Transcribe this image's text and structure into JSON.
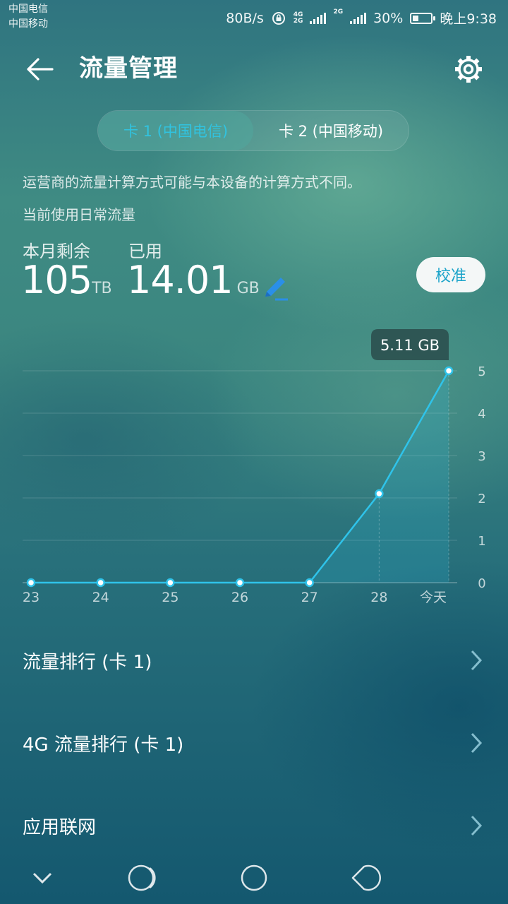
{
  "status_bar": {
    "carrier_1": "中国电信",
    "carrier_2": "中国移动",
    "speed": "80B/s",
    "net_1": "4G",
    "net_1b": "2G",
    "net_2": "2G",
    "battery": "30%",
    "battery_level": 0.3,
    "time": "晚上9:38"
  },
  "header": {
    "title": "流量管理"
  },
  "tabs": [
    {
      "label": "卡 1 (中国电信)",
      "active": true
    },
    {
      "label": "卡 2 (中国移动)",
      "active": false
    }
  ],
  "notice": "运营商的流量计算方式可能与本设备的计算方式不同。",
  "mode_label": "当前使用日常流量",
  "summary": {
    "remaining_label": "本月剩余",
    "remaining_value": "105",
    "remaining_unit": "TB",
    "used_label": "已用",
    "used_value": "14.01",
    "used_unit": "GB",
    "calibrate_label": "校准"
  },
  "chart_data": {
    "type": "area",
    "categories": [
      "23",
      "24",
      "25",
      "26",
      "27",
      "28",
      "今天"
    ],
    "values": [
      0,
      0,
      0,
      0,
      0,
      2.1,
      5.0
    ],
    "yticks": [
      "0",
      "1",
      "2",
      "3",
      "4",
      "5"
    ],
    "ylim": [
      0,
      5
    ],
    "tooltip": "5.11 GB",
    "line_color": "#2fc3ea"
  },
  "list": [
    {
      "label": "流量排行 (卡 1)"
    },
    {
      "label": "4G 流量排行 (卡 1)"
    },
    {
      "label": "应用联网"
    }
  ]
}
